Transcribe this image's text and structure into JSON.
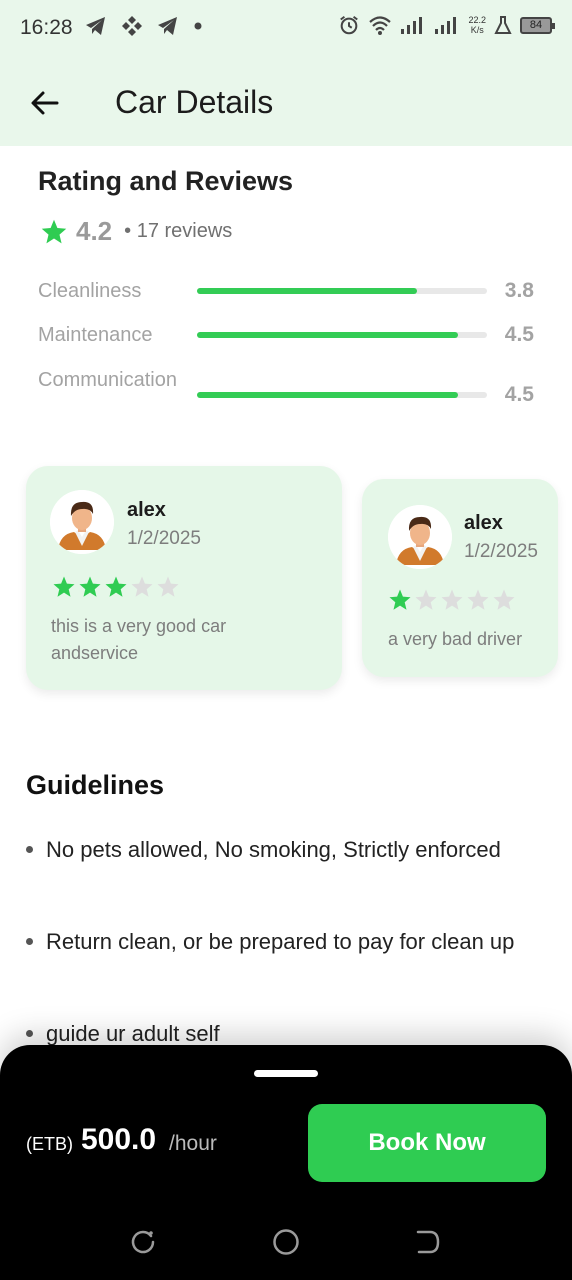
{
  "status_bar": {
    "time": "16:28",
    "net_speed_value": "22.2",
    "net_speed_unit": "K/s",
    "battery": "84"
  },
  "header": {
    "title": "Car Details"
  },
  "ratings": {
    "title": "Rating and Reviews",
    "average": "4.2",
    "reviews_count": "• 17 reviews",
    "metrics": [
      {
        "label": "Cleanliness",
        "value": "3.8",
        "fill": 0.76
      },
      {
        "label": "Maintenance",
        "value": "4.5",
        "fill": 0.9
      },
      {
        "label": "Communication",
        "value": "4.5",
        "fill": 0.9
      }
    ]
  },
  "reviews": [
    {
      "name": "alex",
      "date": "1/2/2025",
      "stars": 3,
      "text": "this is a very good car andservice"
    },
    {
      "name": "alex",
      "date": "1/2/2025",
      "stars": 1,
      "text": "a very bad driver"
    }
  ],
  "guidelines": {
    "title": "Guidelines",
    "items": [
      "No pets allowed, No smoking, Strictly enforced",
      "Return clean, or be prepared to pay for clean up",
      "guide ur adult self"
    ]
  },
  "booking": {
    "currency": "(ETB)",
    "price": "500.0",
    "unit": "/hour",
    "button": "Book Now"
  },
  "colors": {
    "accent": "#2fcc52",
    "header_bg": "#e9f7eb",
    "card_bg": "#e5f7e8",
    "star_empty": "#dddddd"
  }
}
